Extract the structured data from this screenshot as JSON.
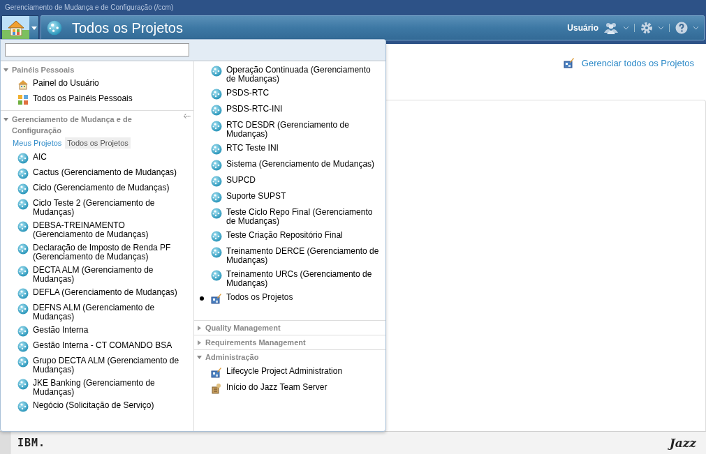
{
  "app_title": "Gerenciamento de Mudança e de Configuração (/ccm)",
  "page_title": "Todos os Projetos",
  "user_menu": {
    "label": "Usuário"
  },
  "manage_link": "Gerenciar todos os Projetos",
  "menu": {
    "left": [
      {
        "title": "Painéis Pessoais",
        "expanded": true,
        "items": [
          {
            "kind": "user-dashboard",
            "label": "Painel do Usuário",
            "selected": false
          },
          {
            "kind": "dashboards",
            "label": "Todos os Painéis Pessoais",
            "selected": false
          }
        ]
      },
      {
        "title": "Gerenciamento de Mudança e de Configuração",
        "expanded": true,
        "tabs": [
          {
            "label": "Meus Projetos",
            "selected": false
          },
          {
            "label": "Todos os Projetos",
            "selected": true
          }
        ],
        "items": [
          {
            "kind": "project",
            "label": "AIC",
            "selected": false
          },
          {
            "kind": "project",
            "label": "Cactus (Gerenciamento de Mudanças)",
            "selected": false
          },
          {
            "kind": "project",
            "label": "Ciclo (Gerenciamento de Mudanças)",
            "selected": false
          },
          {
            "kind": "project",
            "label": "Ciclo Teste 2 (Gerenciamento de Mudanças)",
            "selected": false
          },
          {
            "kind": "project",
            "label": "DEBSA-TREINAMENTO (Gerenciamento de Mudanças)",
            "selected": false
          },
          {
            "kind": "project",
            "label": "Declaração de Imposto de Renda PF (Gerenciamento de Mudanças)",
            "selected": false
          },
          {
            "kind": "project",
            "label": "DECTA ALM (Gerenciamento de Mudanças)",
            "selected": false
          },
          {
            "kind": "project",
            "label": "DEFLA (Gerenciamento de Mudanças)",
            "selected": false
          },
          {
            "kind": "project",
            "label": "DEFNS ALM (Gerenciamento de Mudanças)",
            "selected": false
          },
          {
            "kind": "project",
            "label": "Gestão Interna",
            "selected": false
          },
          {
            "kind": "project",
            "label": "Gestão Interna - CT COMANDO BSA",
            "selected": false
          },
          {
            "kind": "project",
            "label": "Grupo DECTA ALM (Gerenciamento de Mudanças)",
            "selected": false
          },
          {
            "kind": "project",
            "label": "JKE Banking (Gerenciamento de Mudanças)",
            "selected": false
          },
          {
            "kind": "project",
            "label": "Negócio (Solicitação de Serviço)",
            "selected": false
          }
        ]
      }
    ],
    "right": {
      "items": [
        {
          "kind": "project",
          "label": "Operação Continuada (Gerenciamento de Mudanças)",
          "selected": false
        },
        {
          "kind": "project",
          "label": "PSDS-RTC",
          "selected": false
        },
        {
          "kind": "project",
          "label": "PSDS-RTC-INI",
          "selected": false
        },
        {
          "kind": "project",
          "label": "RTC DESDR (Gerenciamento de Mudanças)",
          "selected": false
        },
        {
          "kind": "project",
          "label": "RTC Teste INI",
          "selected": false
        },
        {
          "kind": "project",
          "label": "Sistema (Gerenciamento de Mudanças)",
          "selected": false
        },
        {
          "kind": "project",
          "label": "SUPCD",
          "selected": false
        },
        {
          "kind": "project",
          "label": "Suporte SUPST",
          "selected": false
        },
        {
          "kind": "project",
          "label": "Teste Ciclo Repo Final (Gerenciamento de Mudanças)",
          "selected": false
        },
        {
          "kind": "project",
          "label": "Teste Criação Repositório Final",
          "selected": false
        },
        {
          "kind": "project",
          "label": "Treinamento DERCE (Gerenciamento de Mudanças)",
          "selected": false
        },
        {
          "kind": "project",
          "label": "Treinamento URCs (Gerenciamento de Mudanças)",
          "selected": false
        },
        {
          "kind": "all-projects",
          "label": "Todos os Projetos",
          "selected": true
        }
      ],
      "sections": [
        {
          "title": "Quality Management",
          "expanded": false
        },
        {
          "title": "Requirements Management",
          "expanded": false
        },
        {
          "title": "Administração",
          "expanded": true,
          "items": [
            {
              "kind": "admin",
              "label": "Lifecycle Project Administration",
              "selected": false
            },
            {
              "kind": "server",
              "label": "Início do Jazz Team Server",
              "selected": false
            }
          ]
        }
      ]
    }
  },
  "footer": {
    "left_logo": "IBM.",
    "right_logo": "Jazz"
  }
}
